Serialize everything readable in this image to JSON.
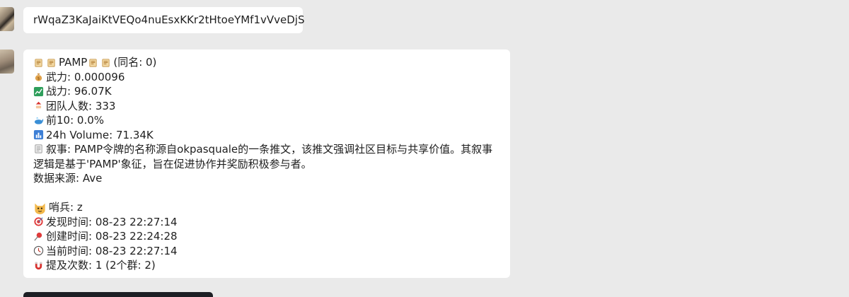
{
  "messages": [
    {
      "text": "rWqaZ3KaJaiKtVEQo4nuEsxKKr2tHtoeYMf1vVveDjS"
    },
    {
      "title": {
        "name": "PAMP",
        "same_name": "(同名: 0)"
      },
      "fields": {
        "wuli": "武力: 0.000096",
        "zhanli": "战力: 96.07K",
        "team": "团队人数: 333",
        "top10": "前10: 0.0%",
        "volume": "24h Volume: 71.34K",
        "narrative": "叙事: PAMP令牌的名称源自okpasquale的一条推文，该推文强调社区目标与共享价值。其叙事逻辑是基于'PAMP'象征，旨在促进协作并奖励积极参与者。",
        "source": "数据来源: Ave",
        "sentry": "哨兵: z",
        "found_time": "发现时间: 08-23 22:27:14",
        "created_time": "创建时间: 08-23 22:24:28",
        "current_time": "当前时间: 08-23 22:27:14",
        "mentions": "提及次数: 1 (2个群: 2)"
      },
      "icons": {
        "scroll": "scroll-icon",
        "money_bag": "money-bag-icon",
        "chart_up": "chart-increasing-icon",
        "santa": "santa-icon",
        "whale": "whale-icon",
        "bar_chart": "bar-chart-icon",
        "memo": "memo-icon",
        "cat": "cat-icon",
        "target": "target-icon",
        "pushpin": "pushpin-icon",
        "clock": "clock-icon",
        "magnet": "magnet-icon"
      }
    }
  ],
  "colors": {
    "background": "#eaeaea",
    "bubble": "#ffffff",
    "text": "#1f1f1f"
  }
}
